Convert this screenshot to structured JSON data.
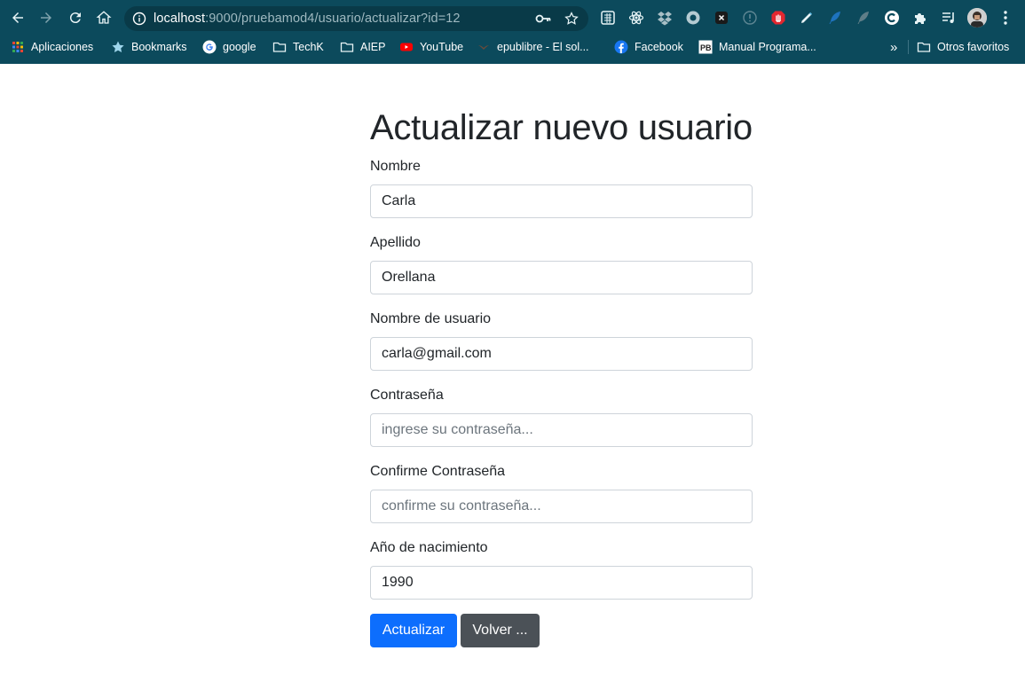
{
  "browser": {
    "url_host": "localhost",
    "url_rest": ":9000/pruebamod4/usuario/actualizar?id=12",
    "bookmarks": [
      {
        "label": "Aplicaciones",
        "icon": "apps-grid-icon"
      },
      {
        "label": "Bookmarks",
        "icon": "star-icon"
      },
      {
        "label": "google",
        "icon": "google-icon"
      },
      {
        "label": "TechK",
        "icon": "folder-icon"
      },
      {
        "label": "AIEP",
        "icon": "folder-icon"
      },
      {
        "label": "YouTube",
        "icon": "youtube-icon"
      },
      {
        "label": "epublibre - El sol...",
        "icon": "epublibre-icon"
      },
      {
        "label": "Facebook",
        "icon": "facebook-icon"
      },
      {
        "label": "Manual Programa...",
        "icon": "pb-icon"
      }
    ],
    "overflow_label": "»",
    "other_bookmarks": "Otros favoritos",
    "colors": {
      "chrome": "#0c4a5c",
      "omnibox": "#093a48"
    }
  },
  "form": {
    "title": "Actualizar nuevo usuario",
    "fields": [
      {
        "label": "Nombre",
        "value": "Carla",
        "placeholder": ""
      },
      {
        "label": "Apellido",
        "value": "Orellana",
        "placeholder": ""
      },
      {
        "label": "Nombre de usuario",
        "value": "carla@gmail.com",
        "placeholder": ""
      },
      {
        "label": "Contraseña",
        "value": "",
        "placeholder": "ingrese su contraseña..."
      },
      {
        "label": "Confirme Contraseña",
        "value": "",
        "placeholder": "confirme su contraseña..."
      },
      {
        "label": "Año de nacimiento",
        "value": "1990",
        "placeholder": ""
      }
    ],
    "submit_label": "Actualizar",
    "back_label": "Volver ...",
    "colors": {
      "primary": "#0d6efd",
      "secondary": "#4b5157"
    }
  }
}
